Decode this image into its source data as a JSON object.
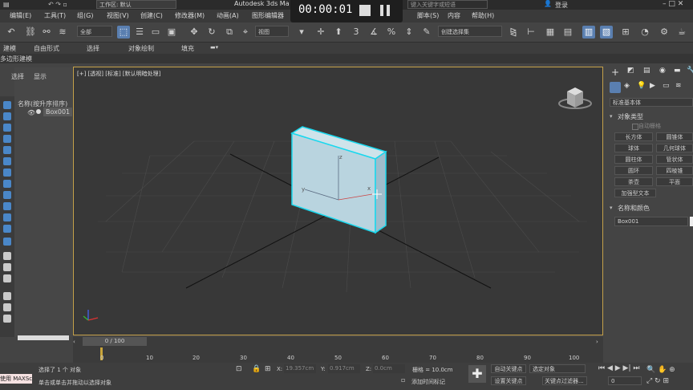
{
  "titlebar": {
    "workspace_label": "工作区: 默认",
    "app_title": "Autodesk 3ds Ma",
    "search_placeholder": "键入关键字或短语",
    "login": "登录"
  },
  "recorder": {
    "time": "00:00:01"
  },
  "menubar": {
    "items": [
      "编辑(E)",
      "工具(T)",
      "组(G)",
      "视图(V)",
      "创建(C)",
      "修改器(M)",
      "动画(A)",
      "图形编辑器",
      "脚本(S)",
      "内容",
      "帮助(H)"
    ]
  },
  "toolbar": {
    "filter_dropdown": "全部",
    "view_dropdown": "视图",
    "selection_set_dropdown": "创建选择集"
  },
  "ribbon": {
    "tabs": [
      "建模",
      "自由形式",
      "选择",
      "对象绘制",
      "填充"
    ],
    "sub_label": "多边形建模"
  },
  "scene_explorer": {
    "tabs": [
      "选择",
      "显示"
    ],
    "sort_header": "名称(按升序排序)",
    "items": [
      "Box001"
    ]
  },
  "viewport": {
    "label": "[+] [透视] [标准] [默认明暗处理]",
    "axis_x": "x",
    "axis_y": "y",
    "axis_z": "z"
  },
  "command_panel": {
    "category_dropdown": "标准基本体",
    "object_type_header": "对象类型",
    "autogrid_label": "自动栅格",
    "buttons": [
      "长方体",
      "圆锥体",
      "球体",
      "几何球体",
      "圆柱体",
      "管状体",
      "圆环",
      "四棱锥",
      "茶壶",
      "平面",
      "加强型文本"
    ],
    "name_color_header": "名称和颜色",
    "name_value": "Box001"
  },
  "timeline": {
    "slider_label": "0 / 100",
    "ticks": [
      "0",
      "10",
      "20",
      "30",
      "40",
      "50",
      "60",
      "70",
      "80",
      "90",
      "100"
    ]
  },
  "statusbar": {
    "script_label": "使用 MAXScr",
    "status_line1": "选择了 1 个 对象",
    "status_line2": "单击或单击并拖动以选择对象",
    "x_label": "X:",
    "x_value": "19.357cm",
    "y_label": "Y:",
    "y_value": "0.917cm",
    "z_label": "Z:",
    "z_value": "0.0cm",
    "grid": "栅格 = 10.0cm",
    "add_time_tag": "添加时间标记",
    "auto_key": "自动关键点",
    "set_key": "设置关键点",
    "selected_dropdown": "选定对象",
    "key_filters": "关键点过滤器...",
    "frame_value": "0"
  },
  "colors": {
    "accent_blue": "#5a7fb0",
    "viewport_border": "#c5a14a",
    "box_fill": "#b9d4df",
    "selection_outline": "#19d8ee"
  }
}
